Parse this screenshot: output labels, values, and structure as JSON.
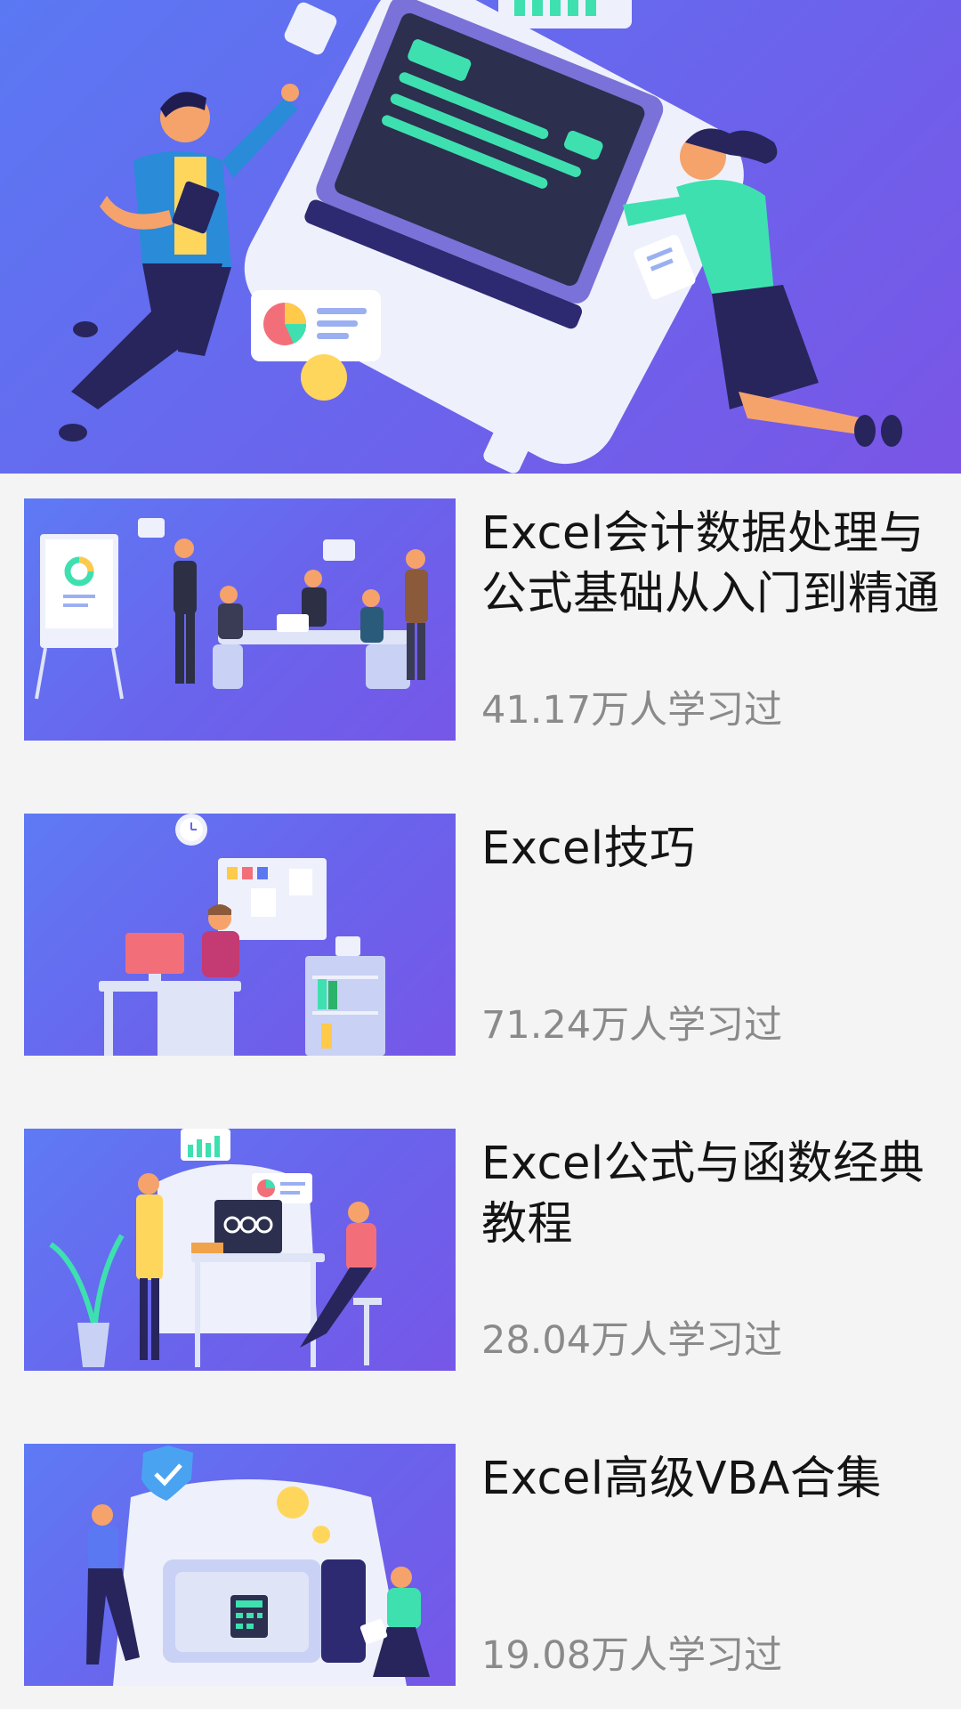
{
  "banner": {
    "icon": "hero-illustration"
  },
  "courses": [
    {
      "title": "Excel会计数据处理与公式基础从入门到精通",
      "learners": "41.17万人学习过",
      "thumb_icon": "meeting-illustration"
    },
    {
      "title": "Excel技巧",
      "learners": "71.24万人学习过",
      "thumb_icon": "office-desk-illustration"
    },
    {
      "title": "Excel公式与函数经典教程",
      "learners": "28.04万人学习过",
      "thumb_icon": "analytics-illustration"
    },
    {
      "title": "Excel高级VBA合集",
      "learners": "19.08万人学习过",
      "thumb_icon": "safe-illustration"
    }
  ],
  "colors": {
    "accent": "#6a64ec",
    "accent_light": "#eef1fb",
    "green": "#3ee0b0",
    "navy": "#2d2a72"
  }
}
